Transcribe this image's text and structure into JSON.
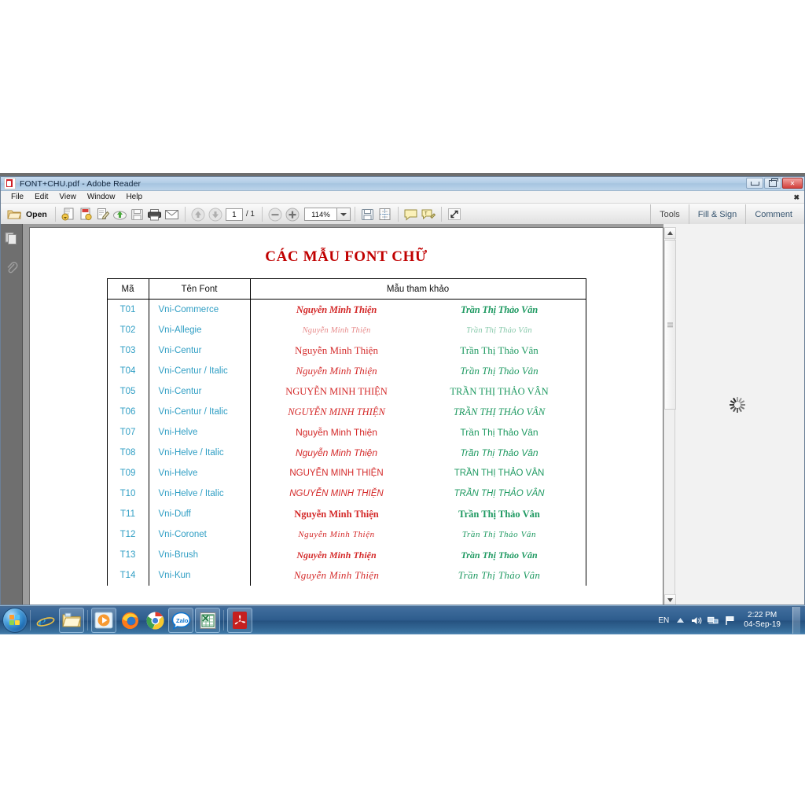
{
  "window": {
    "title": "FONT+CHU.pdf - Adobe Reader",
    "app_icon": "adobe-reader-icon",
    "controls": {
      "minimize": "–",
      "restore": "❐",
      "close": "✕"
    }
  },
  "menubar": {
    "items": [
      "File",
      "Edit",
      "View",
      "Window",
      "Help"
    ],
    "close_toolbar": "✖"
  },
  "toolbar": {
    "open_label": "Open",
    "page_current": "1",
    "page_total": "/ 1",
    "zoom_level": "114%",
    "zoom_dropdown_glyph": "▾",
    "icons": [
      "open-folder-icon",
      "save-as-icon",
      "create-pdf-icon",
      "edit-pdf-icon",
      "upload-cloud-icon",
      "save-icon",
      "print-icon",
      "email-icon",
      "previous-page-icon",
      "next-page-icon",
      "zoom-out-icon",
      "zoom-in-icon",
      "save-file-icon",
      "fit-page-icon",
      "comment-icon",
      "highlight-icon",
      "fullscreen-icon"
    ],
    "right_buttons": [
      "Tools",
      "Fill & Sign",
      "Comment"
    ]
  },
  "navpane": {
    "items": [
      "page-thumbnails-icon",
      "attachments-icon"
    ]
  },
  "scrollbar": {
    "up_arrow": "▲",
    "down_arrow": "▼"
  },
  "document": {
    "title": "CÁC MẪU FONT CHỮ",
    "title_color": "#c00000",
    "columns": [
      "Mã",
      "Tên Font",
      "Mẫu tham khảo"
    ],
    "sample_red": "Nguyễn Minh Thiện",
    "sample_green": "Trần Thị Thảo Vân",
    "red_color": "#d42a2a",
    "green_color": "#1f9a62",
    "code_color": "#2f9ec4",
    "rows": [
      {
        "code": "T01",
        "name": "Vni-Commerce",
        "red": "Nguyễn Minh Thiện",
        "green": "Trần Thị Thảo Vân",
        "style": "v-script"
      },
      {
        "code": "T02",
        "name": "Vni-Allegie",
        "red": "Nguyễn Minh Thiện",
        "green": "Trần Thị Thảo Vân",
        "style": "v-script-light"
      },
      {
        "code": "T03",
        "name": "Vni-Centur",
        "red": "Nguyễn Minh Thiện",
        "green": "Trần Thị Thảo Vân",
        "style": "v-serif"
      },
      {
        "code": "T04",
        "name": "Vni-Centur / Italic",
        "red": "Nguyễn Minh Thiện",
        "green": "Trần Thị Thảo Vân",
        "style": "v-serif-i"
      },
      {
        "code": "T05",
        "name": "Vni-Centur",
        "red": "NGUYỄN MINH THIỆN",
        "green": "TRẦN THỊ THẢO VÂN",
        "style": "v-serif-c"
      },
      {
        "code": "T06",
        "name": "Vni-Centur / Italic",
        "red": "NGUYỄN MINH THIỆN",
        "green": "TRẦN THỊ THẢO VÂN",
        "style": "v-serif-ci"
      },
      {
        "code": "T07",
        "name": "Vni-Helve",
        "red": "Nguyễn Minh Thiện",
        "green": "Trần Thị Thảo Vân",
        "style": "v-sans"
      },
      {
        "code": "T08",
        "name": "Vni-Helve / Italic",
        "red": "Nguyễn Minh Thiện",
        "green": "Trần Thị Thảo Vân",
        "style": "v-sans-i"
      },
      {
        "code": "T09",
        "name": "Vni-Helve",
        "red": "NGUYỄN MINH THIỆN",
        "green": "TRẦN THỊ THẢO VÂN",
        "style": "v-sans-c"
      },
      {
        "code": "T10",
        "name": "Vni-Helve / Italic",
        "red": "NGUYỄN MINH THIỆN",
        "green": "TRẦN THỊ THẢO VÂN",
        "style": "v-sans-ci"
      },
      {
        "code": "T11",
        "name": "Vni-Duff",
        "red": "Nguyễn Minh Thiện",
        "green": "Trần Thị Thảo Vân",
        "style": "v-bold-serif"
      },
      {
        "code": "T12",
        "name": "Vni-Coronet",
        "red": "Nguyễn Minh Thiện",
        "green": "Trần Thị Thảo Vân",
        "style": "v-thin-script"
      },
      {
        "code": "T13",
        "name": "Vni-Brush",
        "red": "Nguyễn Minh Thiện",
        "green": "Trần Thị Thảo Vân",
        "style": "v-brush"
      },
      {
        "code": "T14",
        "name": "Vni-Kun",
        "red": "Nguyễn Minh Thiện",
        "green": "Trần Thị Thảo Vân",
        "style": "v-kun"
      }
    ]
  },
  "cursor": {
    "type": "busy-spinner"
  },
  "taskbar": {
    "start": "start-orb-icon",
    "pinned": [
      "internet-explorer-icon",
      "windows-explorer-icon",
      "windows-media-player-icon",
      "firefox-icon",
      "google-chrome-icon",
      "zalo-icon",
      "microsoft-excel-icon",
      "adobe-reader-icon"
    ],
    "zalo_label": "Zalo",
    "tray": {
      "language": "EN",
      "show_hidden": "▲",
      "volume": "volume-icon",
      "network": "network-icon",
      "action_center": "flag-icon",
      "time": "2:22 PM",
      "date": "04-Sep-19"
    }
  }
}
